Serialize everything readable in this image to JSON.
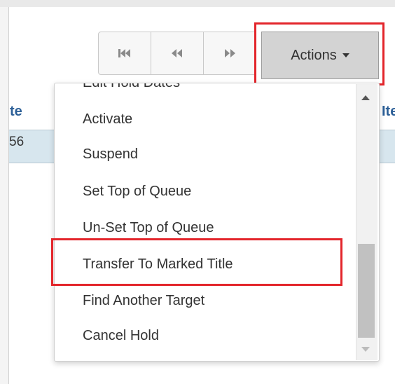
{
  "table": {
    "left_header_fragment": "te",
    "right_header_fragment": "Ite",
    "row_value_fragment": "56"
  },
  "toolbar": {
    "first_icon": "skip-to-start-icon",
    "prev_icon": "rewind-icon",
    "next_icon": "fast-forward-icon",
    "actions_label": "Actions"
  },
  "menu": {
    "items": [
      "Edit Hold Dates",
      "Activate",
      "Suspend",
      "Set Top of Queue",
      "Un-Set Top of Queue",
      "Transfer To Marked Title",
      "Find Another Target",
      "Cancel Hold"
    ]
  },
  "highlight_color": "#e3252b"
}
